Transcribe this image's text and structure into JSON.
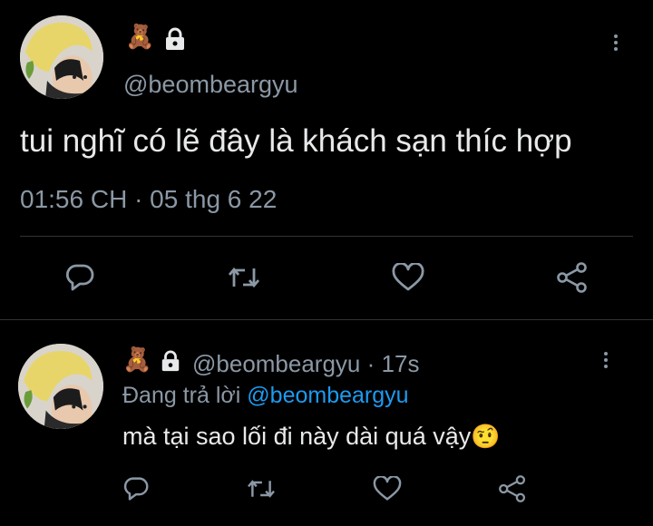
{
  "main_tweet": {
    "avatar_alt": "avatar",
    "name_emoji": "🧸",
    "lock_icon": "lock-icon",
    "handle": "@beombeargyu",
    "text": "tui nghĩ có lẽ đây là khách sạn thíc hợp",
    "timestamp": "01:56 CH · 05 thg 6 22",
    "actions": [
      "reply-icon",
      "retweet-icon",
      "like-icon",
      "share-icon"
    ]
  },
  "reply_tweet": {
    "name_emoji": "🧸",
    "handle": "@beombeargyu",
    "separator": "·",
    "age": "17s",
    "replying_prefix": "Đang trả lời",
    "replying_handle": "@beombeargyu",
    "text": "mà tại sao lối đi này dài quá vậy",
    "text_emoji": "🤨",
    "actions": [
      "reply-icon",
      "retweet-icon",
      "like-icon",
      "share-icon"
    ]
  },
  "colors": {
    "background": "#000000",
    "text": "#e7e9ea",
    "muted": "#8b98a5",
    "link": "#1d9bf0",
    "divider": "#2f3336"
  }
}
